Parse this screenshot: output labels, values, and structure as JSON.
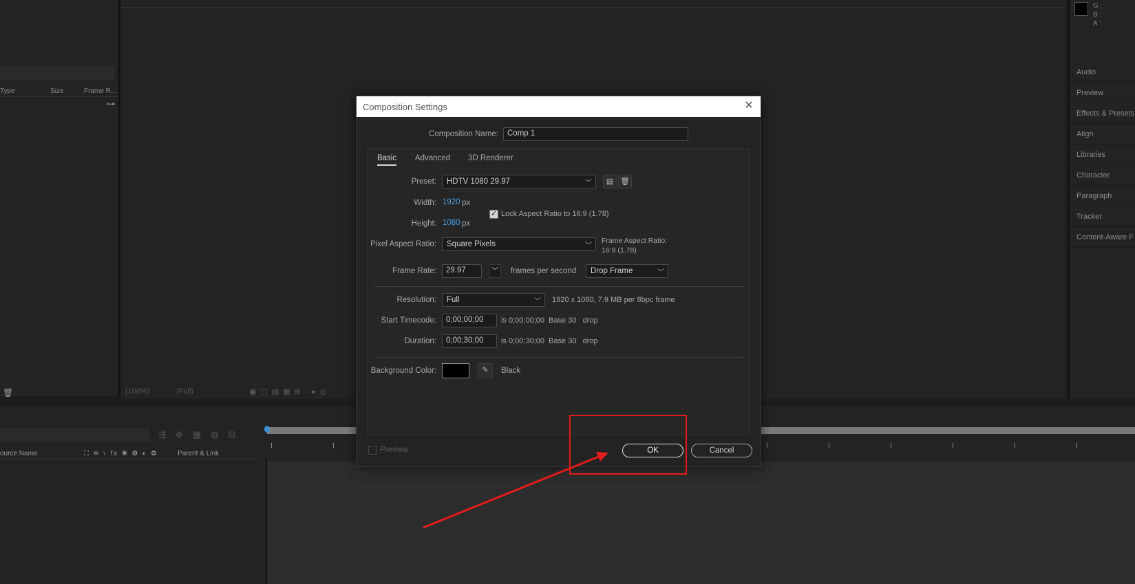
{
  "project_panel": {
    "columns": [
      "Type",
      "Size",
      "Frame R..."
    ]
  },
  "viewer_bar": {
    "zoom": "(100%)",
    "resolution": "(Full)"
  },
  "info_panel": {
    "g": "G :",
    "b": "B :",
    "a": "A :"
  },
  "right_panels": [
    "Audio",
    "Preview",
    "Effects & Presets",
    "Align",
    "Libraries",
    "Character",
    "Paragraph",
    "Tracker",
    "Content-Aware F"
  ],
  "timeline": {
    "col_source": "ource Name",
    "col_parent": "Parent & Link",
    "switch_icons": "⛶ ✲ ∖ fx ▣ ◍ ◐ ◎"
  },
  "dialog": {
    "title": "Composition Settings",
    "comp_name_label": "Composition Name:",
    "comp_name_value": "Comp 1",
    "tabs": [
      "Basic",
      "Advanced",
      "3D Renderer"
    ],
    "preset_label": "Preset:",
    "preset_value": "HDTV 1080 29.97",
    "width_label": "Width:",
    "width_value": "1920",
    "height_label": "Height:",
    "height_value": "1080",
    "px_unit": "px",
    "lock_aspect_label": "Lock Aspect Ratio to 16:9 (1.78)",
    "lock_aspect_checked": true,
    "par_label": "Pixel Aspect Ratio:",
    "par_value": "Square Pixels",
    "frame_aspect_label": "Frame Aspect Ratio:",
    "frame_aspect_value": "16:9 (1.78)",
    "frame_rate_label": "Frame Rate:",
    "frame_rate_value": "29.97",
    "fps_label": "frames per second",
    "drop_frame_value": "Drop Frame",
    "resolution_label": "Resolution:",
    "resolution_value": "Full",
    "resolution_info": "1920 x 1080, 7.9 MB per 8bpc frame",
    "start_tc_label": "Start Timecode:",
    "start_tc_value": "0;00;00;00",
    "start_tc_info": "is 0;00;00;00  Base 30   drop",
    "duration_label": "Duration:",
    "duration_value": "0;00;30;00",
    "duration_info": "is 0;00;30;00  Base 30   drop",
    "bg_color_label": "Background Color:",
    "bg_color_name": "Black",
    "bg_color_hex": "#000000",
    "preview_label": "Preview",
    "ok_label": "OK",
    "cancel_label": "Cancel"
  },
  "annotation_color": "#e21b1b"
}
